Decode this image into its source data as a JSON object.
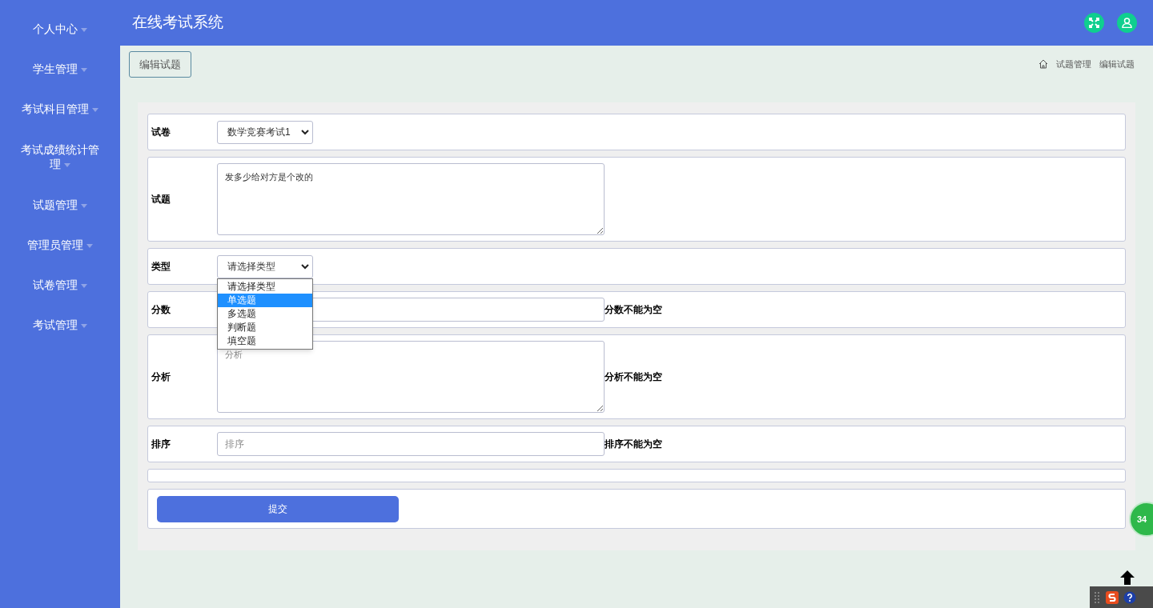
{
  "sidebar": {
    "items": [
      {
        "label": "个人中心"
      },
      {
        "label": "学生管理"
      },
      {
        "label": "考试科目管理"
      },
      {
        "label": "考试成绩统计管理"
      },
      {
        "label": "试题管理"
      },
      {
        "label": "管理员管理"
      },
      {
        "label": "试卷管理"
      },
      {
        "label": "考试管理"
      }
    ]
  },
  "header": {
    "title": "在线考试系统"
  },
  "page_button": "编辑试题",
  "breadcrumb": [
    "试题管理",
    "编辑试题"
  ],
  "form": {
    "rows": [
      {
        "kind": "select",
        "label": "试卷",
        "value": "数学竞赛考试1"
      },
      {
        "kind": "textarea",
        "label": "试题",
        "value": "发多少给对方是个改的"
      },
      {
        "kind": "select",
        "label": "类型",
        "value": "请选择类型",
        "expanded": true,
        "options": [
          {
            "label": "请选择类型",
            "highlighted": false
          },
          {
            "label": "单选题",
            "highlighted": true
          },
          {
            "label": "多选题",
            "highlighted": false
          },
          {
            "label": "判断题",
            "highlighted": false
          },
          {
            "label": "填空题",
            "highlighted": false
          }
        ]
      },
      {
        "kind": "input",
        "label": "分数",
        "error": "分数不能为空"
      },
      {
        "kind": "textarea",
        "label": "分析",
        "placeholder": "分析",
        "error": "分析不能为空"
      },
      {
        "kind": "input",
        "label": "排序",
        "placeholder": "排序",
        "error": "排序不能为空"
      },
      {
        "kind": "blank"
      },
      {
        "kind": "submit",
        "label": "提交"
      }
    ]
  },
  "floating_badge": "34"
}
